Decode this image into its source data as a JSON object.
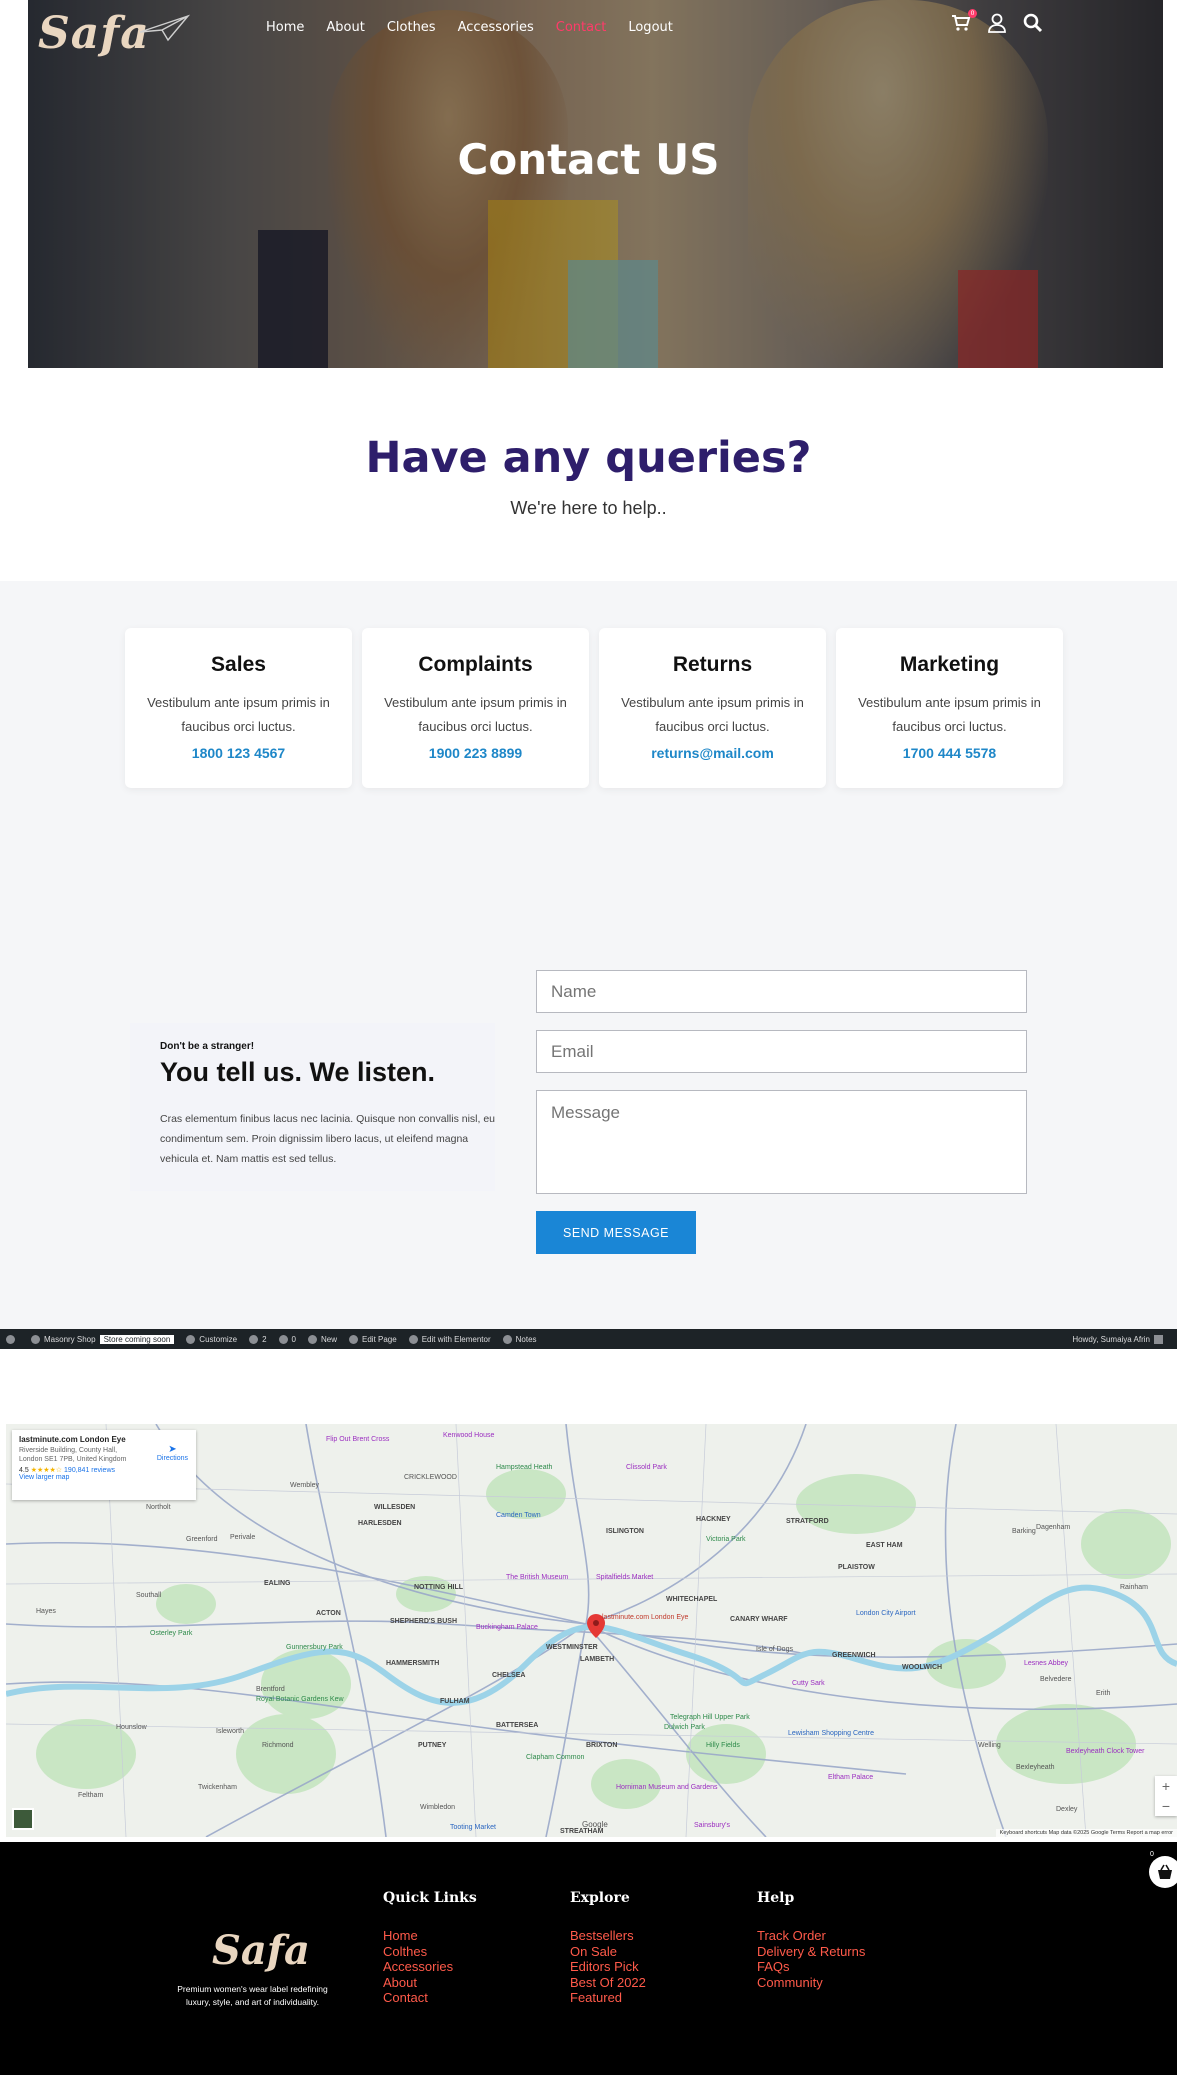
{
  "header": {
    "logo": "Safa",
    "nav": [
      {
        "label": "Home"
      },
      {
        "label": "About"
      },
      {
        "label": "Clothes"
      },
      {
        "label": "Accessories"
      },
      {
        "label": "Contact",
        "active": true
      },
      {
        "label": "Logout"
      }
    ],
    "cart_count": "0",
    "icons": [
      "cart-icon",
      "user-icon",
      "search-icon"
    ]
  },
  "hero": {
    "title": "Contact US"
  },
  "queries": {
    "title": "Have any queries?",
    "subtitle": "We're here to help.."
  },
  "cards": [
    {
      "title": "Sales",
      "text": "Vestibulum ante ipsum primis in faucibus orci luctus.",
      "contact": "1800 123 4567"
    },
    {
      "title": "Complaints",
      "text": "Vestibulum ante ipsum primis in faucibus orci luctus.",
      "contact": "1900 223 8899"
    },
    {
      "title": "Returns",
      "text": "Vestibulum ante ipsum primis in faucibus orci luctus.",
      "contact": "returns@mail.com"
    },
    {
      "title": "Marketing",
      "text": "Vestibulum ante ipsum primis in faucibus orci luctus.",
      "contact": "1700 444 5578"
    }
  ],
  "listen": {
    "kicker": "Don't be a stranger!",
    "title": "You tell us. We listen.",
    "text": "Cras elementum finibus lacus nec lacinia. Quisque non convallis nisl, eu condimentum sem. Proin dignissim libero lacus, ut eleifend magna vehicula et. Nam mattis est sed tellus."
  },
  "form": {
    "name_placeholder": "Name",
    "email_placeholder": "Email",
    "message_placeholder": "Message",
    "send_label": "SEND MESSAGE"
  },
  "adminbar": {
    "site": "Masonry Shop",
    "badge": "Store coming soon",
    "customize": "Customize",
    "updates": "2",
    "comments": "0",
    "new": "New",
    "edit_page": "Edit Page",
    "elementor": "Edit with Elementor",
    "notes": "Notes",
    "howdy": "Howdy, Sumaiya Afrin"
  },
  "map": {
    "place": "lastminute.com London Eye",
    "address": "Riverside Building, County Hall, London SE1 7PB, United Kingdom",
    "rating": "4.5",
    "reviews": "190,841 reviews",
    "larger": "View larger map",
    "directions": "Directions",
    "pin_label": "lastminute.com London Eye",
    "footer": "Keyboard shortcuts   Map data ©2025 Google   Terms   Report a map error",
    "google": "Google",
    "labels": [
      "Wembley",
      "CRICKLEWOOD",
      "Hampstead Heath",
      "Camden Town",
      "ISLINGTON",
      "HACKNEY",
      "STRATFORD",
      "Northolt",
      "Greenford",
      "Perivale",
      "HARLESDEN",
      "WILLESDEN",
      "Kenwood House",
      "Flip Out Brent Cross",
      "Clissold Park",
      "Victoria Park",
      "EAST HAM",
      "PLAISTOW",
      "Barking",
      "Dagenham",
      "Hayes",
      "Southall",
      "EALING",
      "ACTON",
      "NOTTING HILL",
      "SHEPHERD'S BUSH",
      "HAMMERSMITH",
      "FULHAM",
      "CHELSEA",
      "WESTMINSTER",
      "LAMBETH",
      "Buckingham Palace",
      "The British Museum",
      "Spitalfields Market",
      "WHITECHAPEL",
      "CANARY WHARF",
      "Isle of Dogs",
      "GREENWICH",
      "WOOLWICH",
      "Hounslow",
      "Isleworth",
      "Brentford",
      "Richmond",
      "PUTNEY",
      "BATTERSEA",
      "Clapham Common",
      "BRIXTON",
      "Twickenham",
      "Feltham",
      "Wimbledon",
      "STREATHAM",
      "Tooting Market",
      "Dulwich Park",
      "Horniman Museum and Gardens",
      "Hilly Fields",
      "Lewisham Shopping Centre",
      "Eltham Palace",
      "Welling",
      "Bexleyheath",
      "Belvedere",
      "Erith",
      "Rainham",
      "Dexley",
      "London City Airport",
      "Cutty Sark",
      "Osterley Park",
      "Gunnersbury Park",
      "Royal Botanic Gardens Kew",
      "Telegraph Hill Upper Park",
      "Sainsbury's",
      "Lesnes Abbey",
      "Bexleyheath Clock Tower"
    ]
  },
  "footer": {
    "logo": "Safa",
    "tagline": "Premium women's wear label redefining luxury, style, and art of individuality.",
    "basket_count": "0",
    "columns": [
      {
        "title": "Quick Links",
        "links": [
          "Home",
          "Colthes",
          "Accessories",
          "About",
          "Contact"
        ]
      },
      {
        "title": "Explore",
        "links": [
          "Bestsellers",
          "On Sale",
          "Editors Pick",
          "Best Of 2022",
          "Featured"
        ]
      },
      {
        "title": "Help",
        "links": [
          "Track Order",
          "Delivery & Returns",
          "FAQs",
          "Community"
        ]
      }
    ]
  },
  "colors": {
    "accent": "#ff3b6a",
    "heading": "#2e1e6b",
    "link": "#1e87c8",
    "button": "#1a86d6",
    "footer_link": "#ff5a4a"
  }
}
